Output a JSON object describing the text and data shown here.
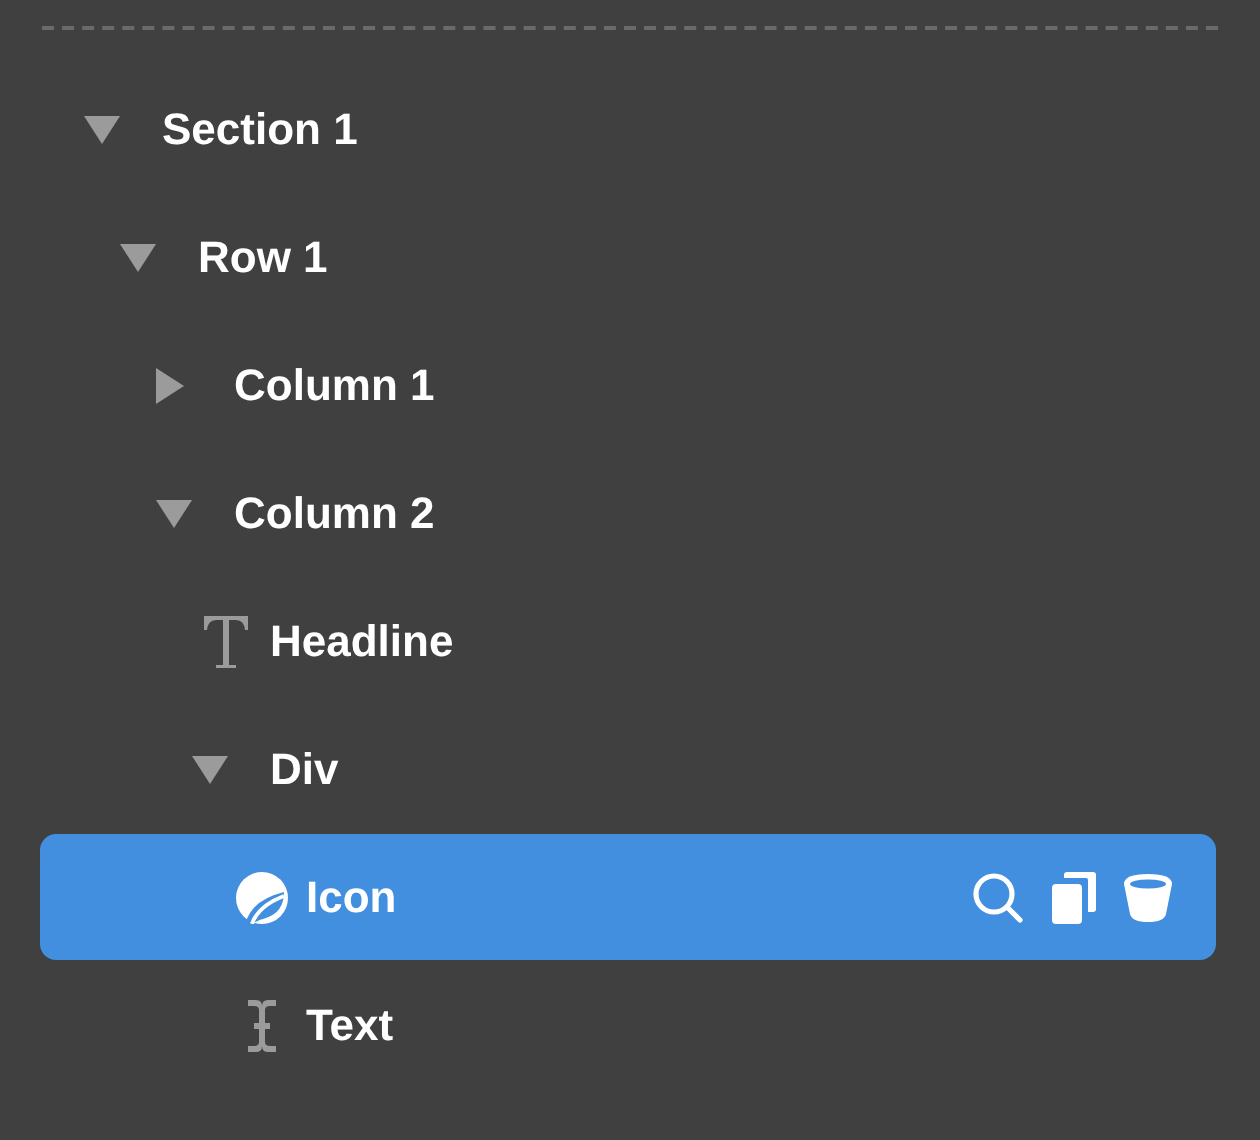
{
  "tree": [
    {
      "label": "Section 1",
      "kind": "container",
      "expanded": true,
      "selected": false,
      "children": [
        {
          "label": "Row 1",
          "kind": "container",
          "expanded": true,
          "selected": false,
          "children": [
            {
              "label": "Column 1",
              "kind": "container",
              "expanded": false,
              "selected": false
            },
            {
              "label": "Column 2",
              "kind": "container",
              "expanded": true,
              "selected": false,
              "children": [
                {
                  "label": "Headline",
                  "kind": "headline",
                  "selected": false
                },
                {
                  "label": "Div",
                  "kind": "container",
                  "expanded": true,
                  "selected": false,
                  "children": [
                    {
                      "label": "Icon",
                      "kind": "icon",
                      "selected": true
                    },
                    {
                      "label": "Text",
                      "kind": "text",
                      "selected": false
                    }
                  ]
                }
              ]
            }
          ]
        }
      ]
    }
  ]
}
